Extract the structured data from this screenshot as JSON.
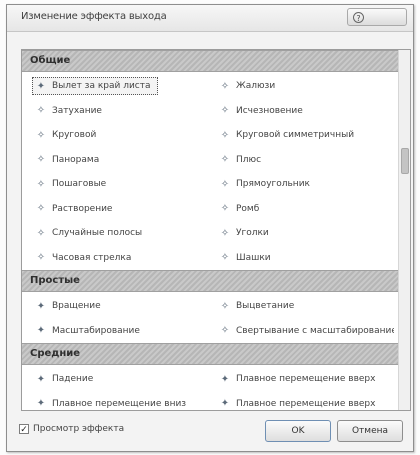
{
  "window": {
    "title": "Изменение эффекта выхода",
    "help_label": "?"
  },
  "groups": [
    {
      "header": "Общие",
      "items": [
        {
          "label": "Вылет за край листа",
          "icon": "star-arrow-icon",
          "selected": true
        },
        {
          "label": "Жалюзи",
          "icon": "star-icon"
        },
        {
          "label": "Затухание",
          "icon": "star-icon"
        },
        {
          "label": "Исчезновение",
          "icon": "star-icon"
        },
        {
          "label": "Круговой",
          "icon": "star-icon"
        },
        {
          "label": "Круговой симметричный",
          "icon": "star-icon"
        },
        {
          "label": "Панорама",
          "icon": "star-icon"
        },
        {
          "label": "Плюс",
          "icon": "star-icon"
        },
        {
          "label": "Пошаговые",
          "icon": "star-icon"
        },
        {
          "label": "Прямоугольник",
          "icon": "star-icon"
        },
        {
          "label": "Растворение",
          "icon": "star-icon"
        },
        {
          "label": "Ромб",
          "icon": "star-icon"
        },
        {
          "label": "Случайные полосы",
          "icon": "star-icon"
        },
        {
          "label": "Уголки",
          "icon": "star-icon"
        },
        {
          "label": "Часовая стрелка",
          "icon": "star-icon"
        },
        {
          "label": "Шашки",
          "icon": "star-icon"
        }
      ]
    },
    {
      "header": "Простые",
      "items": [
        {
          "label": "Вращение",
          "icon": "star-arrow-icon"
        },
        {
          "label": "Выцветание",
          "icon": "star-icon"
        },
        {
          "label": "Масштабирование",
          "icon": "star-arrow-icon"
        },
        {
          "label": "Свертывание с масштабированием",
          "icon": "star-icon"
        }
      ]
    },
    {
      "header": "Средние",
      "items": [
        {
          "label": "Падение",
          "icon": "star-arrow-icon"
        },
        {
          "label": "Плавное перемещение вверх",
          "icon": "star-arrow-icon"
        },
        {
          "label": "Плавное перемещение вниз",
          "icon": "star-arrow-icon"
        },
        {
          "label": "Плавное перемещение вверх",
          "icon": "star-arrow-icon"
        }
      ]
    }
  ],
  "footer": {
    "preview_label": "Просмотр эффекта",
    "preview_checked": true,
    "ok_label": "OK",
    "cancel_label": "Отмена"
  }
}
